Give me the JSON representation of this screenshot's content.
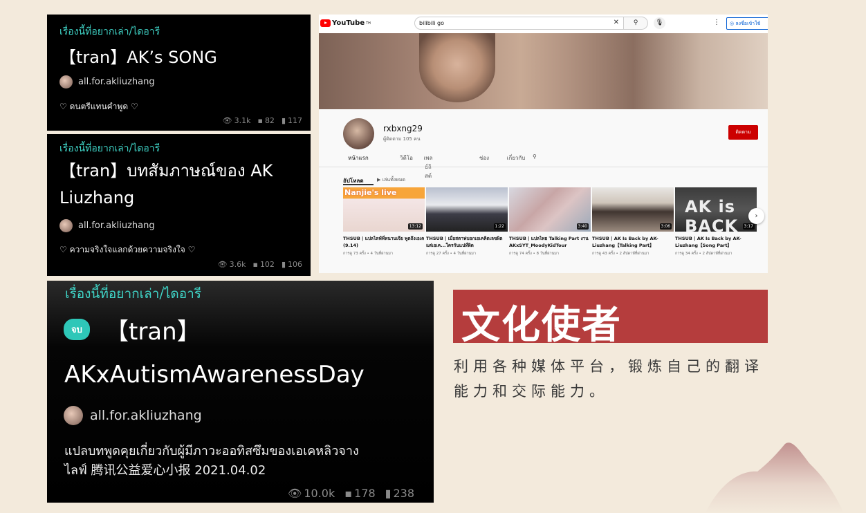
{
  "cards": [
    {
      "category": "เรื่องนี้ที่อยากเล่า/ไดอารี",
      "title": "【tran】AK’s SONG",
      "author": "all.for.akliuzhang",
      "description": "♡ ดนตรีแทนคำพูด ♡",
      "views": "3.1k",
      "comments": "82",
      "pages": "117"
    },
    {
      "category": "เรื่องนี้ที่อยากเล่า/ไดอารี",
      "title": "【tran】บทสัมภาษณ์ของ AK Liuzhang",
      "author": "all.for.akliuzhang",
      "description": "♡ ความจริงใจแลกด้วยความจริงใจ ♡",
      "views": "3.6k",
      "comments": "102",
      "pages": "106"
    },
    {
      "category": "เรื่องนี้ที่อยากเล่า/ไดอารี",
      "badge": "จบ",
      "title_line1": "【tran】",
      "title_line2": "AKxAutismAwarenessDay",
      "author": "all.for.akliuzhang",
      "description_line1": "แปลบทพูดคุยเกี่ยวกับผู้มีภาวะออทิสซึมของเอเคหลิวจาง",
      "description_line2": "ไลฟ์ 腾讯公益爱心小报 2021.04.02",
      "views": "10.0k",
      "comments": "178",
      "pages": "238"
    }
  ],
  "youtube": {
    "logo": "YouTube",
    "logo_sup": "TH",
    "search_value": "bilibili go",
    "signin": "ลงชื่อเข้าใช้",
    "channel_name": "rxbxng29",
    "subscribers": "ผู้ติดตาม 105 คน",
    "subscribe": "ติดตาม",
    "tabs": [
      "หน้าแรก",
      "วิดีโอ",
      "เพลย์ลิสต์",
      "ช่อง",
      "เกี่ยวกับ"
    ],
    "uploads_label": "อัปโหลด",
    "play_all": "เล่นทั้งหมด",
    "videos": [
      {
        "overlay": "Nanjie's live",
        "duration": "13:12",
        "title": "THSUB | แปลไลฟ์พี่หนานเจีย พูดถึงเอเค (9.14)",
        "meta": "การดู 73 ครั้ง • 4 วันที่ผ่านมา"
      },
      {
        "overlay": "",
        "duration": "1:22",
        "title": "THSUB | เมื่อสตาฟบอกเอเคคิดเลขผิด แต่เอเค...ใครกันแน่ที่ผิด",
        "meta": "การดู 27 ครั้ง • 4 วันที่ผ่านมา"
      },
      {
        "overlay": "",
        "duration": "3:40",
        "title": "THSUB | แปลไทย Talking Part งาน AKxSYT_MoodyKidTour",
        "meta": "การดู 74 ครั้ง • 8 วันที่ผ่านมา"
      },
      {
        "overlay": "",
        "duration": "3:06",
        "title": "THSUB | AK Is Back by AK-Liuzhang【Talking Part】",
        "meta": "การดู 43 ครั้ง • 2 สัปดาห์ที่ผ่านมา"
      },
      {
        "overlay": "AK is BACK",
        "duration": "3:17",
        "title": "THSUB | AK Is Back by AK-Liuzhang【Song Part】",
        "meta": "การดู 34 ครั้ง • 2 สัปดาห์ที่ผ่านมา"
      }
    ]
  },
  "envoy": {
    "title": "文化使者",
    "description": "利用各种媒体平台，锻炼自己的翻译能力和交际能力。"
  },
  "colors": {
    "background": "#f3eadc",
    "accent_red": "#b53d3d",
    "teal": "#3fd3c6"
  }
}
